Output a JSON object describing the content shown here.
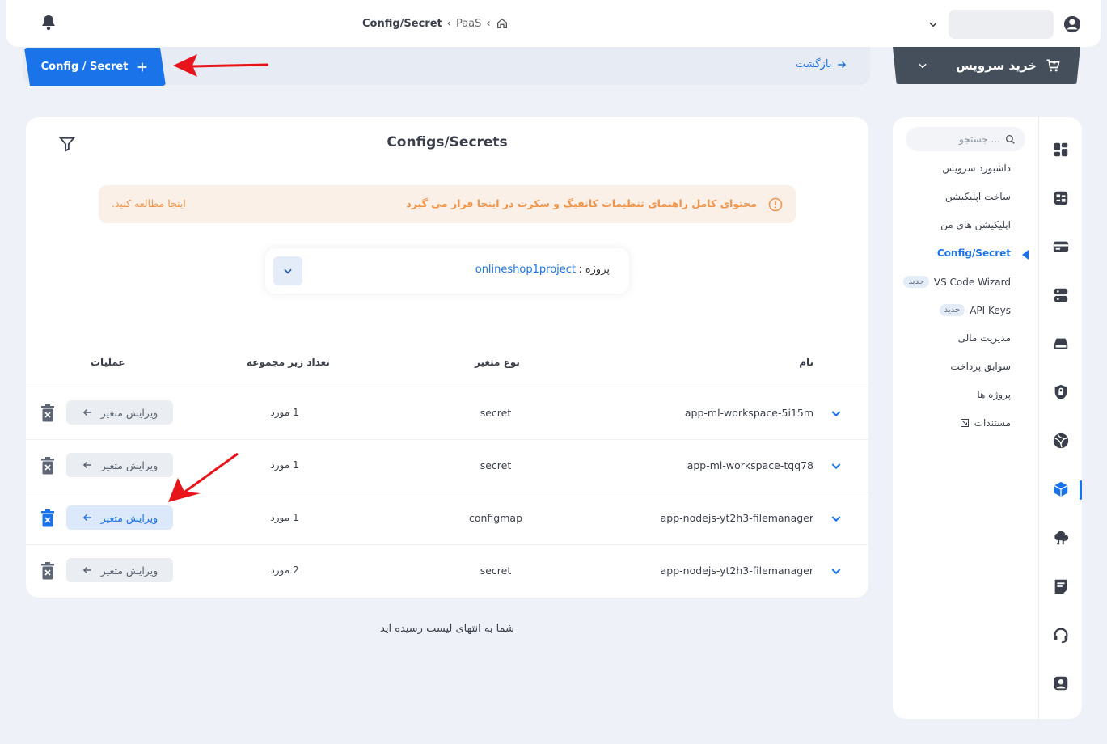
{
  "header": {
    "breadcrumb": {
      "current": "Config/Secret",
      "parent": "PaaS",
      "sep1": "‹",
      "sep2": "‹"
    }
  },
  "tabs": {
    "new_config": "Config / Secret",
    "back": "بازگشت"
  },
  "buy_service": "خرید سرویس",
  "main": {
    "title": "Configs/Secrets",
    "alert": {
      "message": "محتوای کامل راهنمای تنظیمات کانفیگ و سکرت در اینجا قرار می گیرد",
      "link": "اینجا مطالعه کنید."
    },
    "project": {
      "label": "پروژه :",
      "value": "onlineshop1project"
    },
    "columns": {
      "name": "نام",
      "type": "نوع متغیر",
      "count": "تعداد زیر مجموعه",
      "actions": "عملیات"
    },
    "rows": [
      {
        "name": "app-ml-workspace-5i15m",
        "type": "secret",
        "count": "1 مورد",
        "edit": "ویرایش متغیر"
      },
      {
        "name": "app-ml-workspace-tqq78",
        "type": "secret",
        "count": "1 مورد",
        "edit": "ویرایش متغیر"
      },
      {
        "name": "app-nodejs-yt2h3-filemanager",
        "type": "configmap",
        "count": "1 مورد",
        "edit": "ویرایش متغیر"
      },
      {
        "name": "app-nodejs-yt2h3-filemanager",
        "type": "secret",
        "count": "2 مورد",
        "edit": "ویرایش متغیر"
      }
    ],
    "end_message": "شما به انتهای لیست رسیده اید"
  },
  "sidebar": {
    "search_placeholder": "جستجو ...",
    "items": [
      {
        "label": "داشبورد سرویس"
      },
      {
        "label": "ساخت اپلیکیشن"
      },
      {
        "label": "اپلیکیشن های من"
      },
      {
        "label": "Config/Secret"
      },
      {
        "label": "VS Code Wizard",
        "badge": "جدید"
      },
      {
        "label": "API Keys",
        "badge": "جدید"
      },
      {
        "label": "مدیریت مالی"
      },
      {
        "label": "سوابق پرداخت"
      },
      {
        "label": "پروژه ها"
      },
      {
        "label": "مستندات"
      }
    ]
  },
  "colors": {
    "accent": "#1a73e8",
    "dark": "#454f5b",
    "alert_text": "#f0954a",
    "alert_bg": "#fbf0e8",
    "annotation": "#e8141c"
  }
}
